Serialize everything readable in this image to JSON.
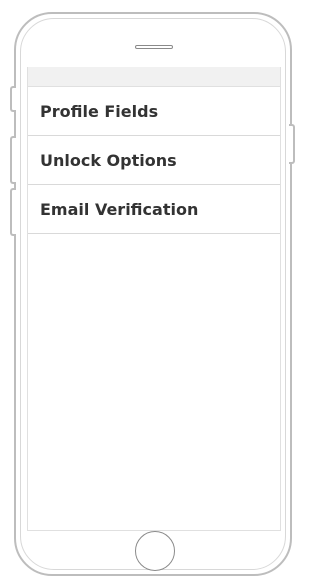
{
  "menu": {
    "items": [
      {
        "label": "Profile Fields"
      },
      {
        "label": "Unlock Options"
      },
      {
        "label": "Email Verification"
      }
    ]
  },
  "colors": {
    "frame": "#bdbdbd",
    "topbar": "#f1f1f1",
    "divider": "#d9d9d9",
    "text": "#333333"
  }
}
